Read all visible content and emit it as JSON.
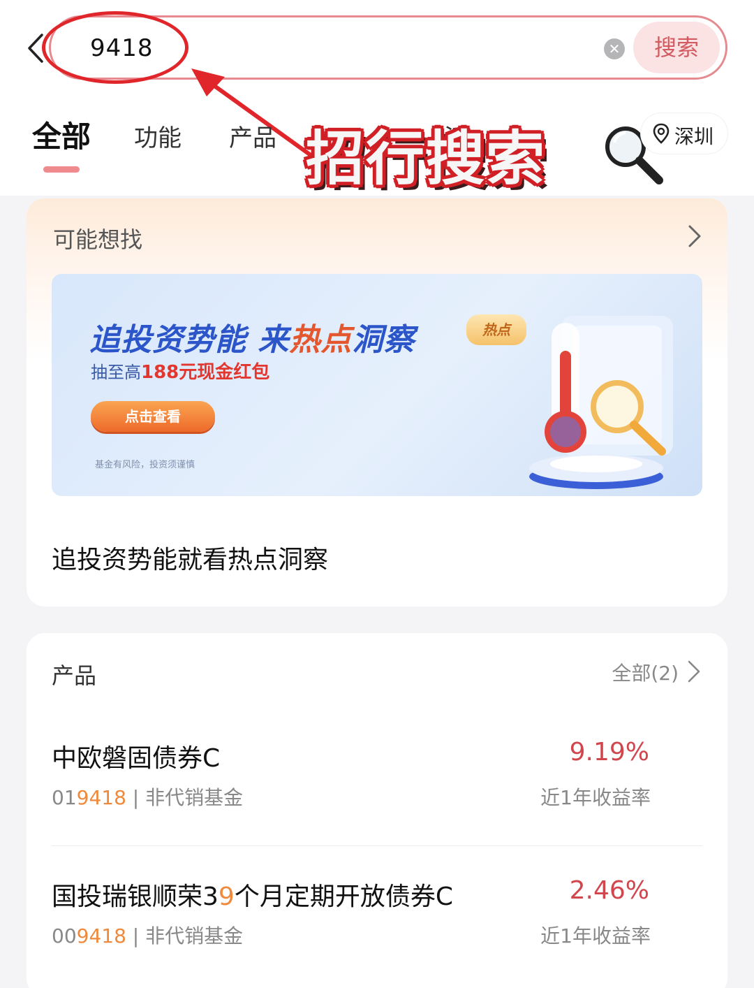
{
  "header": {
    "search_value": "9418",
    "search_button": "搜索",
    "overlay_title": "招行搜索"
  },
  "tabs": [
    {
      "label": "全部"
    },
    {
      "label": "功能"
    },
    {
      "label": "产品"
    },
    {
      "label": "活"
    }
  ],
  "location": {
    "label": "深圳"
  },
  "suggest": {
    "title": "可能想找",
    "banner": {
      "headline_a": "追投资势能 来",
      "headline_hot": "热点",
      "headline_b": "洞察",
      "sub_prefix": "抽至高",
      "sub_bold": "188元现金红包",
      "cta": "点击查看",
      "badge": "热点",
      "risk": "基金有风险，投资须谨慎"
    },
    "caption": "追投资势能就看热点洞察"
  },
  "products": {
    "title": "产品",
    "all_label": "全部(2)",
    "items": [
      {
        "name": "中欧磐固债券C",
        "code_prefix": "01",
        "code_match": "9418",
        "tag": " | 非代销基金",
        "rate": "9.19%",
        "rate_label": "近1年收益率"
      },
      {
        "name_a": "国投瑞银顺荣3",
        "name_hl": "9",
        "name_b": "个月定期开放债券C",
        "code_prefix": "00",
        "code_match": "9418",
        "tag": " | 非代销基金",
        "rate": "2.46%",
        "rate_label": "近1年收益率"
      }
    ]
  },
  "colors": {
    "accent_red": "#d0464c",
    "highlight_orange": "#ef8a3c",
    "search_border": "#e68a8f"
  }
}
